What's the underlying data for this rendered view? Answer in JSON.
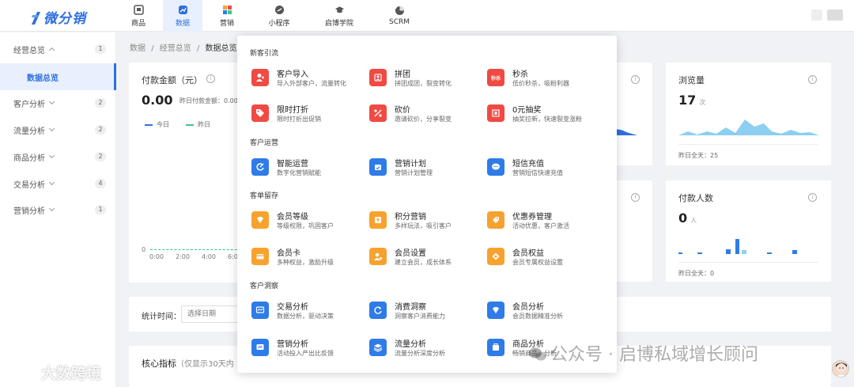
{
  "app": {
    "logo_text": "微分销"
  },
  "nav": [
    {
      "label": "商品",
      "icon": "store-icon"
    },
    {
      "label": "数据",
      "icon": "chart-icon"
    },
    {
      "label": "营销",
      "icon": "grid-icon"
    },
    {
      "label": "小程序",
      "icon": "link-icon"
    },
    {
      "label": "启博学院",
      "icon": "graduation-cap-icon"
    },
    {
      "label": "SCRM",
      "icon": "pie-icon"
    }
  ],
  "sidebar": [
    {
      "label": "经营总览",
      "badge": "1"
    },
    {
      "label": "数据总览"
    },
    {
      "label": "客户分析",
      "badge": "2"
    },
    {
      "label": "流量分析",
      "badge": "2"
    },
    {
      "label": "商品分析",
      "badge": "2"
    },
    {
      "label": "交易分析",
      "badge": "4"
    },
    {
      "label": "营销分析",
      "badge": "1"
    }
  ],
  "breadcrumb": {
    "a": "数据",
    "sep": "/",
    "b": "经营总览",
    "c": "数据总览"
  },
  "pay_card": {
    "title": "付款金额（元）",
    "value": "0.00",
    "sub": "昨日付款金额：0.00",
    "legend_today": "今日",
    "legend_yesterday": "昨日",
    "zero": "0",
    "ticks": [
      "0:00",
      "2:00",
      "4:00",
      "6:0"
    ]
  },
  "views_card": {
    "title": "浏览量",
    "value": "17",
    "unit": "次",
    "footer": "昨日全天：25"
  },
  "payers_card": {
    "title": "付款人数",
    "value": "0",
    "unit": "人",
    "footer": "昨日全天：0"
  },
  "filter": {
    "label": "统计时间：",
    "placeholder": "选择日期"
  },
  "metrics": {
    "title": "核心指标",
    "sub": "（仅显示30天内"
  },
  "popup": {
    "sections": [
      {
        "title": "新客引流",
        "items": [
          {
            "title": "客户导入",
            "desc": "导入外部客户，流量转化",
            "icon": "user-import-icon"
          },
          {
            "title": "拼团",
            "desc": "拼团成团，裂变转化",
            "icon": "group-buy-icon"
          },
          {
            "title": "秒杀",
            "desc": "低价秒杀，吸粉利器",
            "icon": "flash-sale-icon",
            "badge": "秒杀"
          },
          {
            "title": "限时打折",
            "desc": "限时打折出促销",
            "icon": "discount-tag-icon"
          },
          {
            "title": "砍价",
            "desc": "邀请砍价，分享裂变",
            "icon": "bargain-icon"
          },
          {
            "title": "0元抽奖",
            "desc": "抽奖拉新，快速裂变涨粉",
            "icon": "lottery-icon"
          }
        ]
      },
      {
        "title": "客户运营",
        "items": [
          {
            "title": "智能运营",
            "desc": "数字化营销赋能",
            "icon": "smart-ops-icon"
          },
          {
            "title": "营销计划",
            "desc": "营销计划管理",
            "icon": "plan-icon"
          },
          {
            "title": "短信充值",
            "desc": "营销短信快速充值",
            "icon": "sms-icon"
          }
        ]
      },
      {
        "title": "客单留存",
        "items": [
          {
            "title": "会员等级",
            "desc": "等级权限，巩固客户",
            "icon": "diamond-icon"
          },
          {
            "title": "积分营销",
            "desc": "多样玩法，吸引客户",
            "icon": "points-icon"
          },
          {
            "title": "优惠券管理",
            "desc": "活动优惠，客户激活",
            "icon": "coupon-icon"
          },
          {
            "title": "会员卡",
            "desc": "多种权益，激励升级",
            "icon": "member-card-icon"
          },
          {
            "title": "会员设置",
            "desc": "建立会员，成长体系",
            "icon": "member-settings-icon"
          },
          {
            "title": "会员权益",
            "desc": "会员专属权益设置",
            "icon": "member-benefit-icon"
          }
        ]
      },
      {
        "title": "客户洞察",
        "items": [
          {
            "title": "交易分析",
            "desc": "数据分析，驱动决策",
            "icon": "trade-analysis-icon"
          },
          {
            "title": "消费洞察",
            "desc": "洞察客户消费能力",
            "icon": "refresh-icon"
          },
          {
            "title": "会员分析",
            "desc": "会员数据精准分析",
            "icon": "member-analysis-icon"
          },
          {
            "title": "营销分析",
            "desc": "活动投入产出比反馈",
            "icon": "marketing-analysis-icon"
          },
          {
            "title": "流量分析",
            "desc": "流量分析深度分析",
            "icon": "layers-icon"
          },
          {
            "title": "商品分析",
            "desc": "畅销商品，分析",
            "icon": "goods-analysis-icon"
          }
        ]
      }
    ]
  },
  "watermarks": {
    "wechat": "公众号 · 启博私域增长顾问",
    "brand": "大数跨境"
  },
  "colors": {
    "primary": "#2f6fe0",
    "red": "#f04a43",
    "orange": "#f7a22f",
    "blue": "#2f7be8",
    "chart_fill": "#8ccff0"
  }
}
